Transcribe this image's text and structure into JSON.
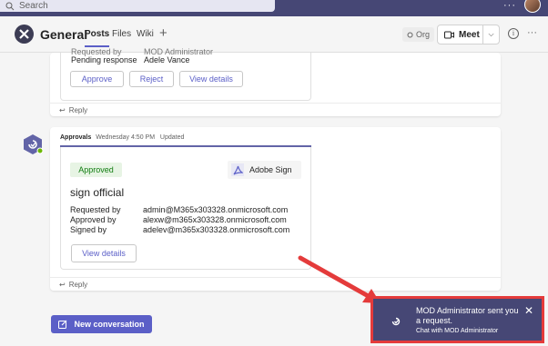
{
  "topbar": {
    "search_placeholder": "Search",
    "more": "···"
  },
  "header": {
    "channel_name": "General",
    "tabs": [
      {
        "label": "Posts"
      },
      {
        "label": "Files"
      },
      {
        "label": "Wiki"
      }
    ],
    "add_tab": "+",
    "org_label": "Org",
    "meet_label": "Meet",
    "more": "···"
  },
  "post1": {
    "requested_by_label": "Requested by",
    "requested_by_value": "MOD Administrator",
    "pending_label": "Pending response",
    "pending_value": "Adele Vance",
    "buttons": {
      "approve": "Approve",
      "reject": "Reject",
      "details": "View details"
    },
    "reply": "Reply"
  },
  "post2": {
    "sender": "Approvals",
    "time": "Wednesday 4:50 PM",
    "status_note": "Updated",
    "badge": "Approved",
    "provider": "Adobe Sign",
    "title": "sign official",
    "rows": [
      {
        "label": "Requested by",
        "value": "admin@M365x303328.onmicrosoft.com"
      },
      {
        "label": "Approved by",
        "value": "alexw@m365x303328.onmicrosoft.com"
      },
      {
        "label": "Signed by",
        "value": "adelev@m365x303328.onmicrosoft.com"
      }
    ],
    "details_button": "View details",
    "reply": "Reply"
  },
  "compose": {
    "new_conversation": "New conversation"
  },
  "toast": {
    "title": "MOD Administrator sent you a request.",
    "subtitle": "Chat with MOD Administrator",
    "close": "✕"
  },
  "colors": {
    "brand": "#5b5fc7",
    "toolbar": "#464775",
    "highlight": "#e43b3b",
    "approved": "#107c10"
  }
}
